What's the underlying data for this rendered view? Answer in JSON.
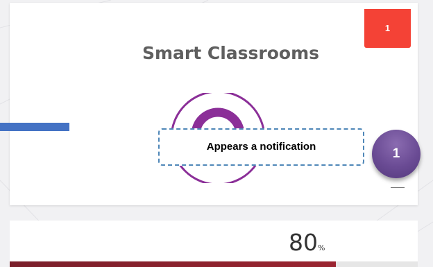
{
  "card": {
    "title": "Smart Classrooms",
    "notification_count": "1",
    "percent_value": "80",
    "percent_sign": "%",
    "progress_fraction": 0.8
  },
  "annotation": {
    "callout_text": "Appears a notification",
    "step_number": "1"
  },
  "colors": {
    "badge": "#f44236",
    "gauge": "#8b2f98",
    "progress": "#7a1f2b",
    "step_circle": "#6a4b94",
    "callout_border": "#4f87b8",
    "pointer_bar": "#4472c4"
  }
}
